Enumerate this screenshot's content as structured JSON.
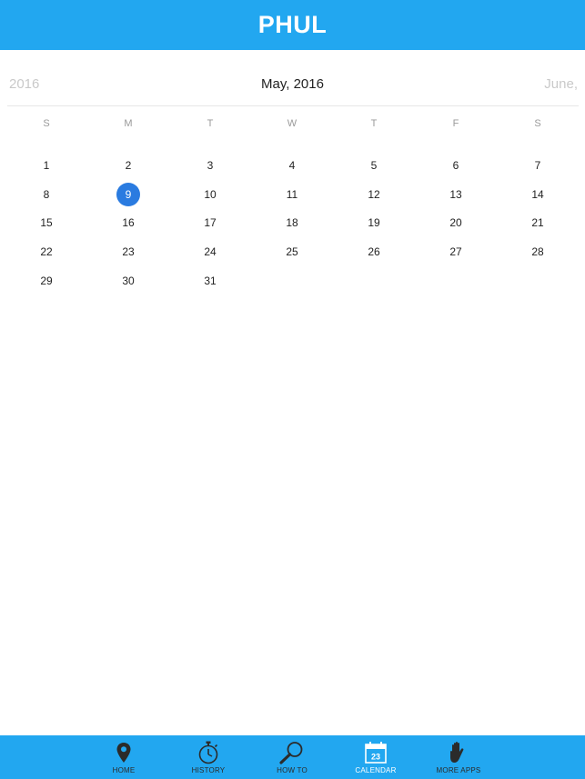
{
  "header": {
    "title": "PHUL"
  },
  "month_bar": {
    "prev": "2016",
    "current": "May, 2016",
    "next": "June,"
  },
  "weekdays": [
    "S",
    "M",
    "T",
    "W",
    "T",
    "F",
    "S"
  ],
  "calendar": {
    "days": [
      "1",
      "2",
      "3",
      "4",
      "5",
      "6",
      "7",
      "8",
      "9",
      "10",
      "11",
      "12",
      "13",
      "14",
      "15",
      "16",
      "17",
      "18",
      "19",
      "20",
      "21",
      "22",
      "23",
      "24",
      "25",
      "26",
      "27",
      "28",
      "29",
      "30",
      "31"
    ],
    "selected": "9",
    "accent_color": "#2a7be0"
  },
  "tabbar": {
    "bg_color": "#22a7f0",
    "active": "calendar",
    "tabs": [
      {
        "id": "home",
        "label": "HOME",
        "icon": "map-pin-icon"
      },
      {
        "id": "history",
        "label": "HISTORY",
        "icon": "stopwatch-icon"
      },
      {
        "id": "howto",
        "label": "HOW TO",
        "icon": "magnifier-icon"
      },
      {
        "id": "calendar",
        "label": "CALENDAR",
        "icon": "calendar-icon",
        "icon_text": "23"
      },
      {
        "id": "moreapps",
        "label": "MORE APPS",
        "icon": "hand-icon"
      }
    ]
  }
}
